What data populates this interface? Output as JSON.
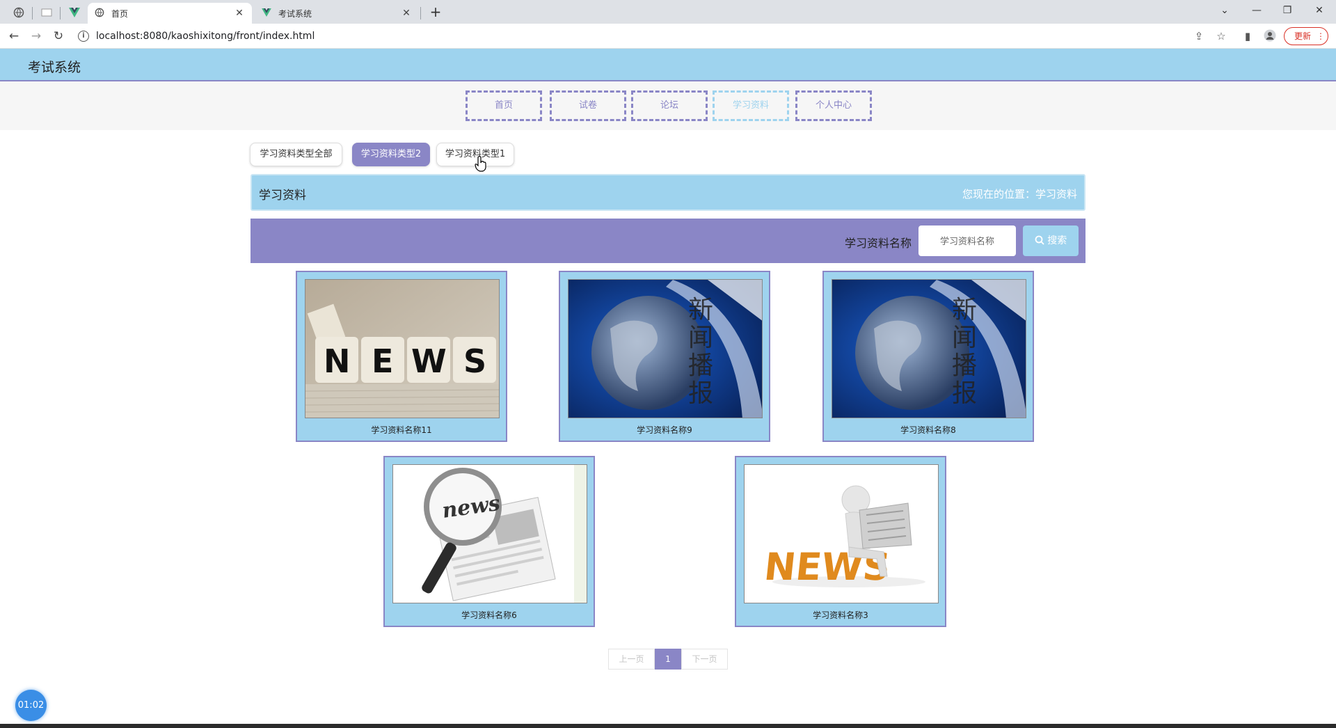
{
  "browser": {
    "tabs": [
      {
        "title": "首页",
        "active": true
      },
      {
        "title": "考试系统",
        "active": false
      }
    ],
    "url": "localhost:8080/kaoshixitong/front/index.html",
    "update_label": "更新"
  },
  "site": {
    "title": "考试系统",
    "nav": [
      "首页",
      "试卷",
      "论坛",
      "学习资料",
      "个人中心"
    ],
    "active_nav": "学习资料"
  },
  "filters": {
    "items": [
      "学习资料类型全部",
      "学习资料类型2",
      "学习资料类型1"
    ],
    "active": "学习资料类型2"
  },
  "banner": {
    "title": "学习资料",
    "location": "您现在的位置：学习资料"
  },
  "search": {
    "label": "学习资料名称",
    "placeholder": "学习资料名称",
    "button": "搜索"
  },
  "cards": [
    {
      "name": "学习资料名称11",
      "image": "news-cubes"
    },
    {
      "name": "学习资料名称9",
      "image": "news-globe"
    },
    {
      "name": "学习资料名称8",
      "image": "news-globe"
    },
    {
      "name": "学习资料名称6",
      "image": "news-magnifier"
    },
    {
      "name": "学习资料名称3",
      "image": "news-reader"
    }
  ],
  "globe_caption": "新闻播报",
  "pager": {
    "prev": "上一页",
    "current": "1",
    "next": "下一页"
  },
  "timer": "01:02",
  "colors": {
    "primary_blue": "#9ed3ee",
    "primary_purple": "#8a86c6"
  }
}
